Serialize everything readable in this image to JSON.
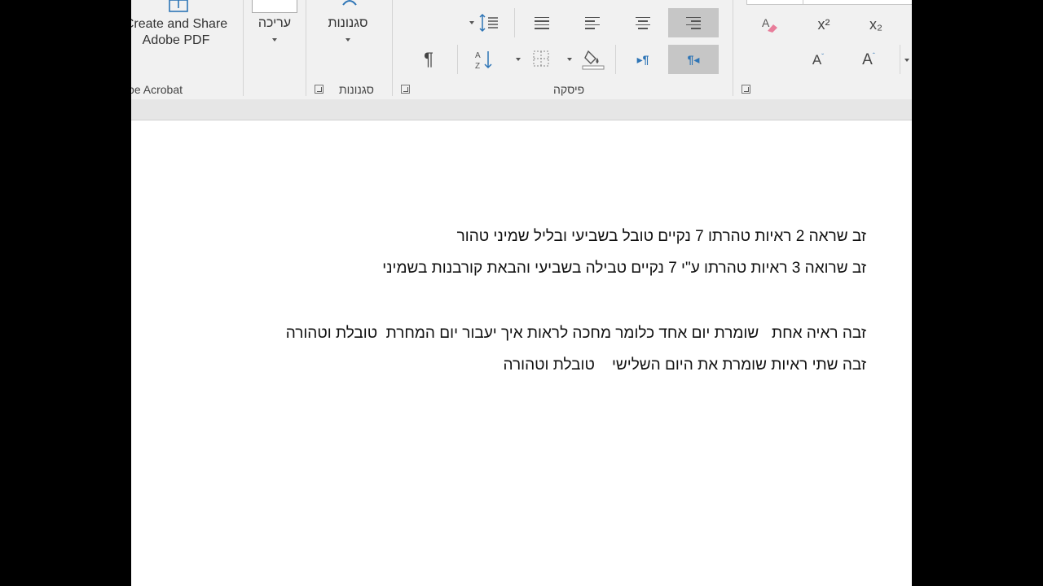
{
  "ribbon": {
    "acrobat": {
      "button_line1": "Create and Share",
      "button_line2": "Adobe PDF",
      "group_label": "Adobe Acrobat"
    },
    "editing": {
      "label": "עריכה"
    },
    "styles": {
      "button_label": "סגנונות",
      "group_label": "סגנונות"
    },
    "paragraph": {
      "group_label": "פיסקה"
    },
    "font": {
      "superscript_icon": "x²",
      "subscript_icon": "x₂"
    }
  },
  "document": {
    "paragraphs": [
      "זב שראה 2 ראיות טהרתו 7 נקיים טובל בשביעי ובליל שמיני טהור",
      "זב שרואה 3 ראיות טהרתו ע\"י 7 נקיים טבילה בשביעי והבאת קורבנות בשמיני",
      "",
      "זבה ראיה אחת   שומרת יום אחד כלומר מחכה לראות איך יעבור יום המחרת  טובלת וטהורה",
      "זבה שתי ראיות שומרת את היום השלישי    טובלת וטהורה"
    ]
  }
}
